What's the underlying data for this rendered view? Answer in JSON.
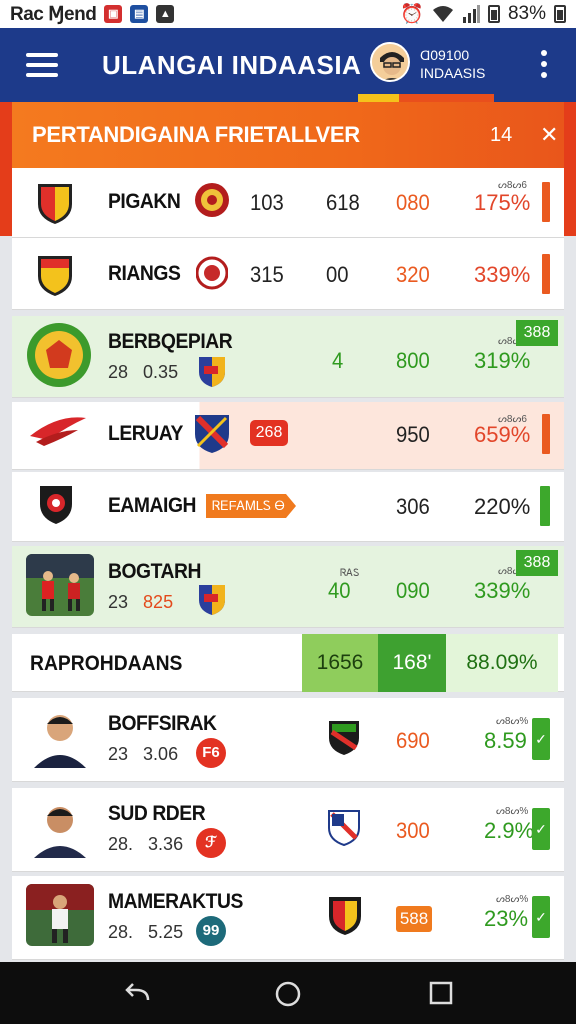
{
  "status_bar": {
    "carrier": "Rac Ɱend",
    "battery_text": "83%"
  },
  "app_bar": {
    "title": "ULANGAI INDAASIA",
    "user_line1": "Ɑ09100",
    "user_line2": "INDAASIS"
  },
  "section": {
    "title": "PERTANDIGAINA FRIETALLVER",
    "count": "14",
    "close": "✕"
  },
  "rows": [
    {
      "name": "PIGAKN",
      "n1": "103",
      "n2": "618",
      "n3": "080",
      "small": "ᔕ8ᔕ6",
      "pct": "175%"
    },
    {
      "name": "RIANGS",
      "n1": "315",
      "n2": "00",
      "n3": "320",
      "pct": "339%"
    },
    {
      "name": "BERBQEPIAR",
      "sub_a": "28",
      "sub_b": "0.35",
      "n2": "4",
      "n3": "800",
      "small": "ᔕ8ᔕ%",
      "pct": "319%",
      "tag": "388"
    },
    {
      "name": "LERUAY",
      "badge": "268",
      "n3": "950",
      "small": "ᔕ8ᔕ6",
      "pct": "659%"
    },
    {
      "name": "EAMAIGH",
      "badge": "ᏒᎬFᎪᎷLᏚ Ꮎ",
      "n3": "306",
      "pct": "220%"
    },
    {
      "name": "BOGTARH",
      "sub_a": "23",
      "sub_b": "825",
      "small_a": "ᏒᎪᏚ",
      "n2": "40",
      "n3": "090",
      "small": "ᔕ8ᔕ%",
      "pct": "339%",
      "tag": "388"
    },
    {
      "name": "BOFFSIRAK",
      "sub_a": "23",
      "sub_b": "3.06",
      "badge": "F6",
      "n3": "690",
      "small": "ᔕ8ᔕ%",
      "pct": "8.59"
    },
    {
      "name": "SUD RDER",
      "sub_a": "28.",
      "sub_b": "3.36",
      "badge": "ℱ",
      "n3": "300",
      "small": "ᔕ8ᔕ%",
      "pct": "2.9%"
    },
    {
      "name": "MAMERAKTUS",
      "sub_a": "28.",
      "sub_b": "5.25",
      "badge": "99",
      "n3": "588",
      "small": "ᔕ8ᔕ%",
      "pct": "23%"
    }
  ],
  "summary": {
    "label": "RAPROHDAANS",
    "c1": "1656",
    "c2": "168'",
    "c3": "88.09%"
  },
  "icons": {
    "hamburger": "menu-icon",
    "kebab": "more-vert-icon",
    "back": "back-icon",
    "home": "home-icon",
    "recents": "recents-icon"
  },
  "colors": {
    "app_bar": "#1d3a8a",
    "section_orange": "#f0691a",
    "green": "#3da82c",
    "orange": "#ea5a20",
    "red": "#e2462a"
  }
}
